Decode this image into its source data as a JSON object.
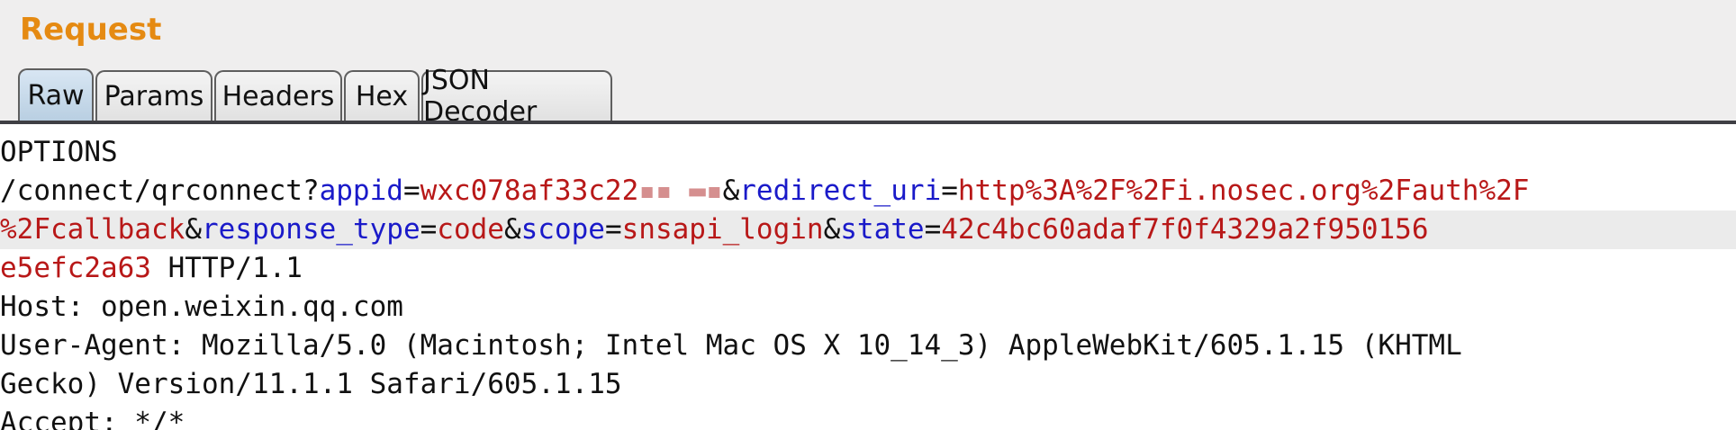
{
  "panel": {
    "title": "Request"
  },
  "tabs": [
    {
      "label": "Raw",
      "active": true
    },
    {
      "label": "Params",
      "active": false
    },
    {
      "label": "Headers",
      "active": false
    },
    {
      "label": "Hex",
      "active": false
    },
    {
      "label": "JSON Decoder",
      "active": false
    }
  ],
  "request": {
    "line1": "OPTIONS",
    "line2": {
      "prefix": "/connect/qrconnect?",
      "appid_key": "appid",
      "eq1": "=",
      "appid_value": "wxc078af33c22",
      "appid_redacted": "▪▪ ▬▪",
      "amp1": "&",
      "redirect_key": "redirect_uri",
      "eq2": "=",
      "redirect_value": "http%3A%2F%2Fi.nosec.org%2Fauth%2F"
    },
    "line3": {
      "redirect_cont": "%2Fcallback",
      "amp2": "&",
      "response_type_key": "response_type",
      "eq3": "=",
      "response_type_value": "code",
      "amp3": "&",
      "scope_key": "scope",
      "eq4": "=",
      "scope_value": "snsapi_login",
      "amp4": "&",
      "state_key": "state",
      "eq5": "=",
      "state_value": "42c4bc60adaf7f0f4329a2f950156"
    },
    "line4": {
      "state_cont": "e5efc2a63",
      "protocol": " HTTP/1.1"
    },
    "line5": "Host: open.weixin.qq.com",
    "line6": "User-Agent: Mozilla/5.0 (Macintosh; Intel Mac OS X 10_14_3) AppleWebKit/605.1.15 (KHTML",
    "line7": "Gecko) Version/11.1.1 Safari/605.1.15",
    "line8": "Accept: */*"
  },
  "colors": {
    "title": "#e58a12",
    "param_key": "#1a1ac9",
    "param_value": "#b81818"
  }
}
